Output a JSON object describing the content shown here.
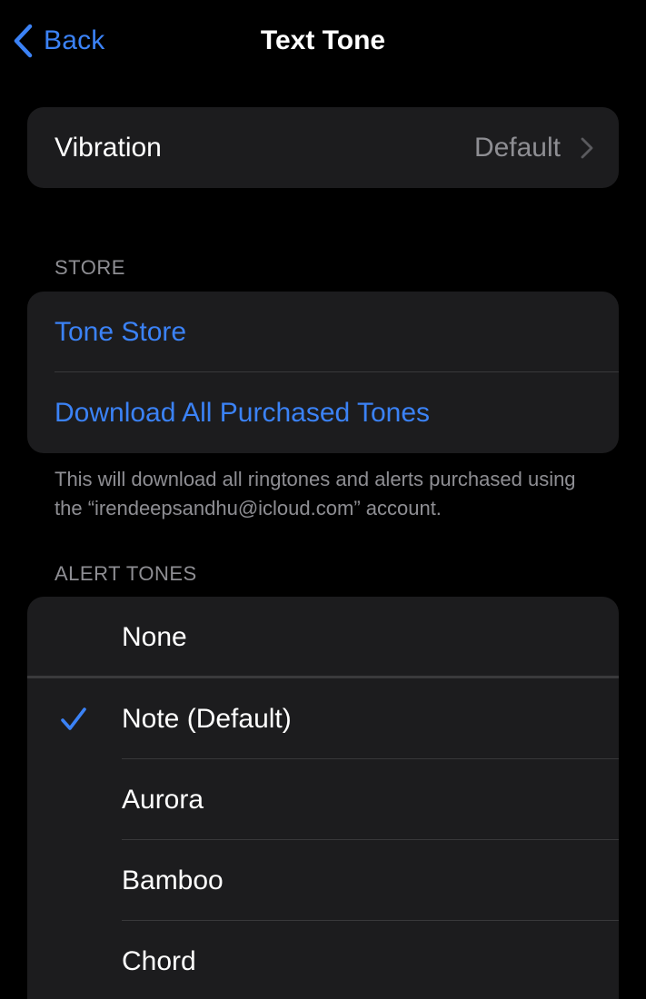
{
  "nav": {
    "back_label": "Back",
    "title": "Text Tone"
  },
  "vibration": {
    "label": "Vibration",
    "value": "Default"
  },
  "store": {
    "header": "STORE",
    "items": [
      {
        "label": "Tone Store"
      },
      {
        "label": "Download All Purchased Tones"
      }
    ],
    "footer": "This will download all ringtones and alerts purchased using the “irendeepsandhu@icloud.com” account."
  },
  "alert_tones": {
    "header": "ALERT TONES",
    "items": [
      {
        "label": "None",
        "selected": false
      },
      {
        "label": "Note (Default)",
        "selected": true
      },
      {
        "label": "Aurora",
        "selected": false
      },
      {
        "label": "Bamboo",
        "selected": false
      },
      {
        "label": "Chord",
        "selected": false
      }
    ]
  },
  "colors": {
    "accent": "#3b82f6",
    "background": "#000000",
    "cell": "#1c1c1e",
    "secondary_text": "#8e8e93"
  },
  "icons": {
    "back": "chevron-left-icon",
    "disclosure": "chevron-right-icon",
    "selected": "checkmark-icon"
  }
}
